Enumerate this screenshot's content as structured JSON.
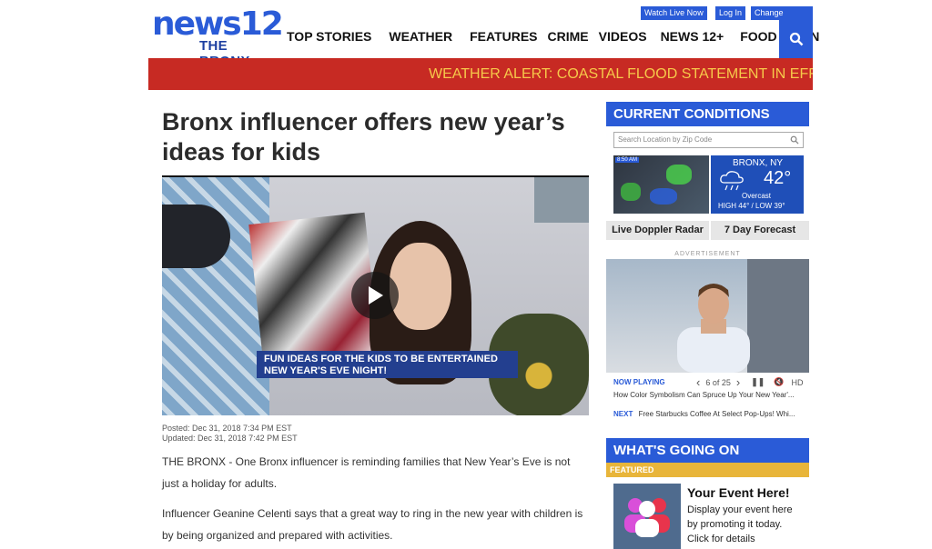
{
  "header": {
    "logo_top": "news12",
    "logo_bottom": "THE BRONX",
    "util_links": [
      "Watch Live Now",
      "Log In",
      "Change Region"
    ],
    "nav": [
      "TOP STORIES",
      "WEATHER",
      "FEATURES",
      "CRIME",
      "VIDEOS",
      "NEWS 12+",
      "FOOD & FUN"
    ]
  },
  "alert": {
    "text": "WEATHER ALERT: COASTAL FLOOD STATEMENT IN EFFECT"
  },
  "article": {
    "title": "Bronx influencer offers new year’s ideas for kids",
    "video_lower_third": "FUN IDEAS FOR THE KIDS TO BE ENTERTAINED NEW YEAR'S EVE NIGHT!",
    "posted": "Posted: Dec 31, 2018 7:34 PM EST",
    "updated": "Updated: Dec 31, 2018 7:42 PM EST",
    "dateline": "THE BRONX - ",
    "p1": "One Bronx influencer is reminding families that New Year’s Eve is not just a holiday for adults.",
    "p2": "Influencer Geanine Celenti says that a great way to ring in the new year with children is by being organized and prepared with activities."
  },
  "conditions": {
    "heading": "CURRENT CONDITIONS",
    "search_placeholder": "Search Location by Zip Code",
    "radar_time": "8:50 AM",
    "location": "BRONX, NY",
    "temp": "42°",
    "desc": "Overcast",
    "hilo": "HIGH 44° / LOW 39°",
    "btn_radar": "Live Doppler Radar",
    "btn_forecast": "7 Day Forecast"
  },
  "ad": {
    "label": "ADVERTISEMENT",
    "now_playing": "NOW PLAYING",
    "counter": "6 of 25",
    "hd": "HD",
    "title": "How Color Symbolism Can Spruce Up Your New Year'...",
    "next_label": "NEXT",
    "next_title": "Free Starbucks Coffee At Select Pop-Ups! Whi..."
  },
  "going_on": {
    "heading": "WHAT'S GOING ON",
    "featured": "FEATURED",
    "event_title": "Your Event Here!",
    "event_text": "Display your event here by promoting it today. Click for details"
  },
  "colors": {
    "brand_blue": "#2a5bd7",
    "alert_red": "#c72a23",
    "alert_text": "#f6c94a",
    "featured_gold": "#e8b53a"
  }
}
